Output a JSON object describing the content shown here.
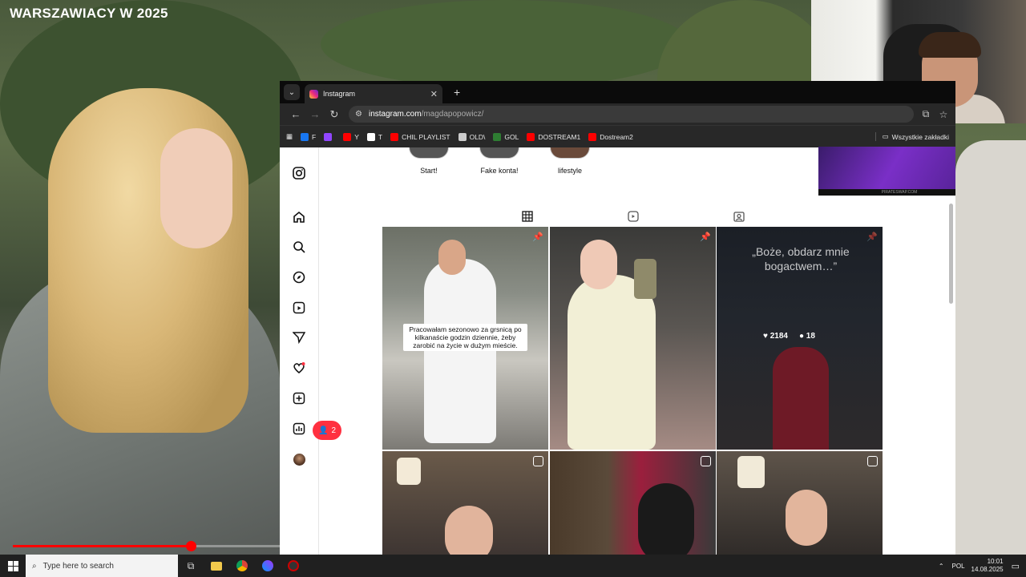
{
  "video": {
    "title": "WARSZAWIACY W 2025",
    "progress_fraction": 0.189
  },
  "browser": {
    "tab": {
      "title": "Instagram",
      "close": "✕",
      "new_tab": "+"
    },
    "address": {
      "host": "instagram.com",
      "path": "/magdapopowicz/"
    },
    "bookmarks": [
      {
        "label": "F",
        "color": "#1877f2"
      },
      {
        "label": "",
        "color": "#9146ff"
      },
      {
        "label": "Y",
        "color": "#ff0000"
      },
      {
        "label": "T",
        "color": "#ffffff"
      },
      {
        "label": "CHIL PLAYLIST",
        "color": "#ff0000"
      },
      {
        "label": "OLD\\",
        "color": "#cccccc"
      },
      {
        "label": "GOL",
        "color": "#2e7d32"
      },
      {
        "label": "DOSTREAM1",
        "color": "#ff0000"
      },
      {
        "label": "Dostream2",
        "color": "#ff0000"
      }
    ],
    "all_bookmarks": "Wszystkie zakładki"
  },
  "instagram": {
    "highlights": [
      "Start!",
      "Fake konta!",
      "lifestyle"
    ],
    "notification_count": "2",
    "ad_footer": "PIRATESWAP.COM",
    "posts": [
      {
        "caption": "Pracowałam sezonowo za grsnicą po kilkanaście godzin dziennie, żeby zarobić na życie w dużym mieście."
      },
      {
        "caption": ""
      },
      {
        "quote": "„Boże, obdarz mnie bogactwem…”",
        "likes": "2184",
        "comments": "18"
      }
    ]
  },
  "taskbar": {
    "search_placeholder": "Type here to search",
    "language": "POL",
    "time": "10:01",
    "date": "14.08.2025"
  },
  "colors": {
    "instagram_badge": "#ff3040",
    "progress": "#ff0000"
  }
}
